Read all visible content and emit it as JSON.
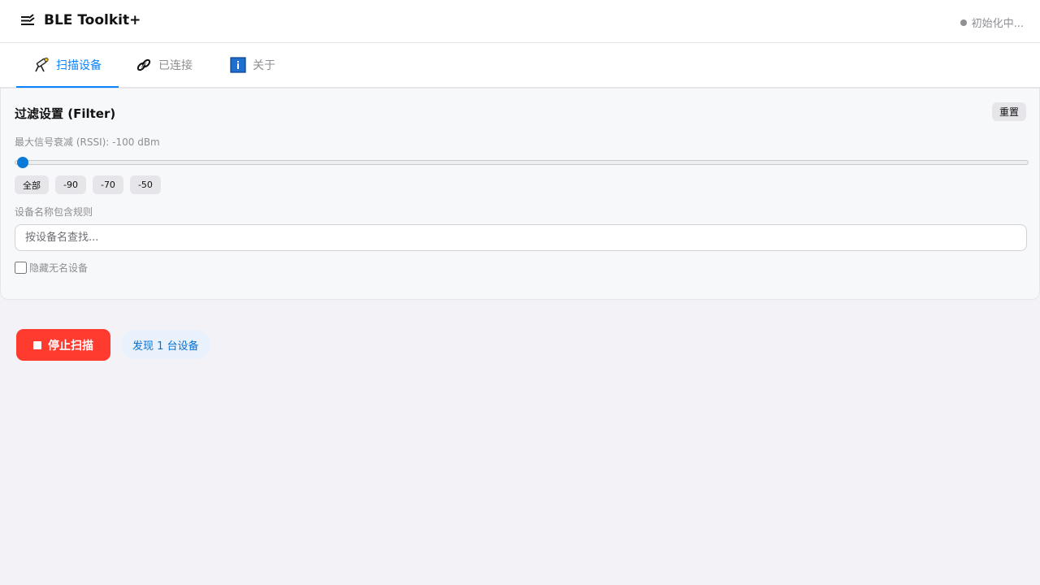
{
  "header": {
    "app_title": "BLE Toolkit+",
    "status_text": "初始化中...",
    "app_icon": "menu-lines-icon"
  },
  "tabs": [
    {
      "label": "扫描设备",
      "icon": "telescope-icon",
      "active": true
    },
    {
      "label": "已连接",
      "icon": "link-icon",
      "active": false
    },
    {
      "label": "关于",
      "icon": "info-icon",
      "active": false
    }
  ],
  "filter": {
    "title": "过滤设置 (Filter)",
    "reset_label": "重置",
    "rssi_label": "最大信号衰减 (RSSI): -100 dBm",
    "rssi_value": -100,
    "rssi_min": -100,
    "rssi_max": -30,
    "presets": [
      "全部",
      "-90",
      "-70",
      "-50"
    ],
    "name_label": "设备名称包含规则",
    "name_placeholder": "按设备名查找...",
    "name_value": "",
    "hide_unnamed_label": "隐藏无名设备",
    "hide_unnamed_checked": false
  },
  "scan": {
    "stop_label": "停止扫描",
    "found_text": "发现 1 台设备"
  },
  "colors": {
    "accent": "#0a84ff",
    "stop": "#ff3b30",
    "background": "#f2f2f7"
  }
}
